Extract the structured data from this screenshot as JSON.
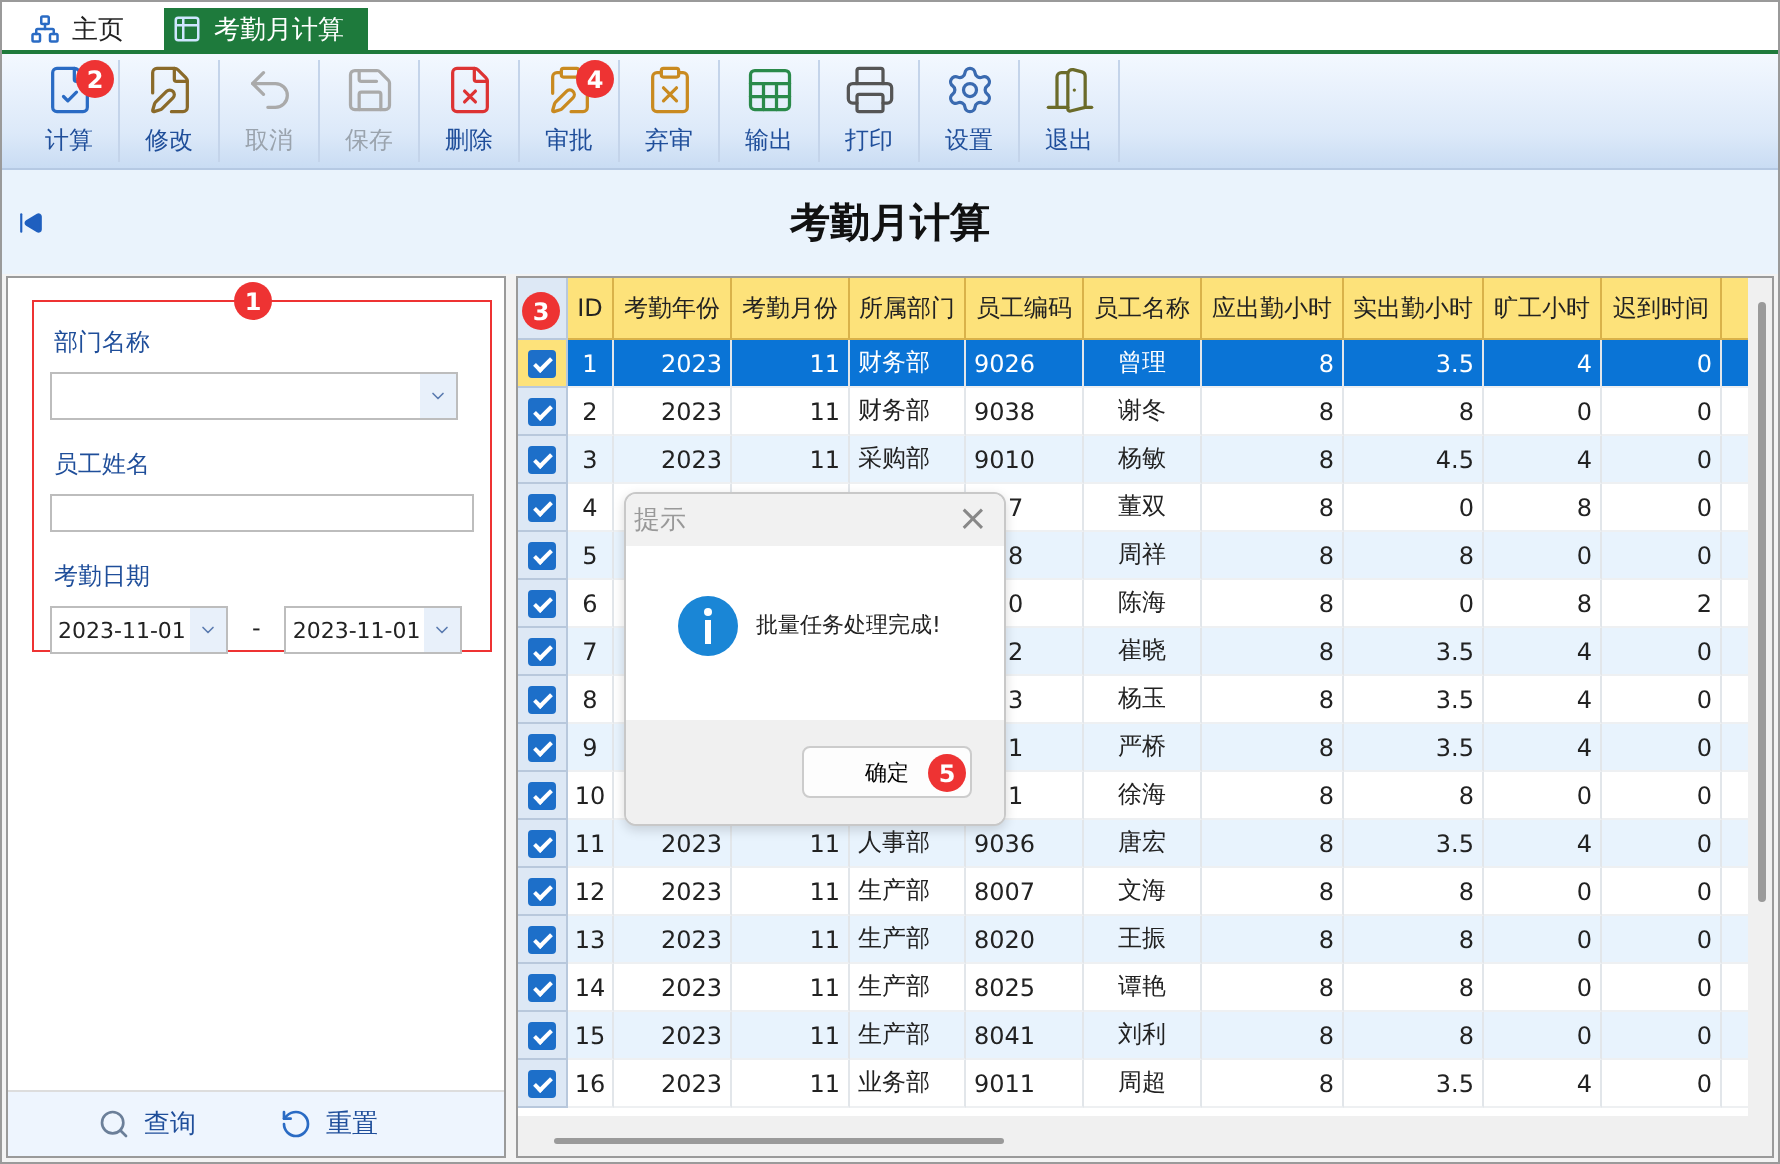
{
  "tabs": [
    {
      "label": "主页",
      "selected": false
    },
    {
      "label": "考勤月计算",
      "selected": true
    }
  ],
  "toolbar": [
    {
      "label": "计算",
      "disabled": false,
      "badge": "2"
    },
    {
      "label": "修改",
      "disabled": false
    },
    {
      "label": "取消",
      "disabled": true
    },
    {
      "label": "保存",
      "disabled": true
    },
    {
      "label": "删除",
      "disabled": false
    },
    {
      "label": "审批",
      "disabled": false,
      "badge": "4"
    },
    {
      "label": "弃审",
      "disabled": false
    },
    {
      "label": "输出",
      "disabled": false
    },
    {
      "label": "打印",
      "disabled": false
    },
    {
      "label": "设置",
      "disabled": false
    },
    {
      "label": "退出",
      "disabled": false
    }
  ],
  "page_title": "考勤月计算",
  "filter": {
    "badge": "1",
    "department_label": "部门名称",
    "name_label": "员工姓名",
    "date_label": "考勤日期",
    "date_from": "2023-11-01",
    "date_separator": "-",
    "date_to": "2023-11-01",
    "buttons": [
      "查询",
      "重置"
    ]
  },
  "table": {
    "header_badge": "3",
    "columns": [
      "ID",
      "考勤年份",
      "考勤月份",
      "所属部门",
      "员工编码",
      "员工名称",
      "应出勤小时",
      "实出勤小时",
      "旷工小时",
      "迟到时间"
    ],
    "rows": [
      {
        "id": "1",
        "year": "2023",
        "month": "11",
        "dept": "财务部",
        "code": "9026",
        "name": "曾理",
        "due": "8",
        "actual": "3.5",
        "absent": "4",
        "late": "0",
        "checked": true,
        "selected": true
      },
      {
        "id": "2",
        "year": "2023",
        "month": "11",
        "dept": "财务部",
        "code": "9038",
        "name": "谢冬",
        "due": "8",
        "actual": "8",
        "absent": "0",
        "late": "0",
        "checked": true,
        "selected": false
      },
      {
        "id": "3",
        "year": "2023",
        "month": "11",
        "dept": "采购部",
        "code": "9010",
        "name": "杨敏",
        "due": "8",
        "actual": "4.5",
        "absent": "4",
        "late": "0",
        "checked": true,
        "selected": false
      },
      {
        "id": "4",
        "code": "7",
        "name": "董双",
        "due": "8",
        "actual": "0",
        "absent": "8",
        "late": "0",
        "checked": true,
        "selected": false
      },
      {
        "id": "5",
        "code": "8",
        "name": "周祥",
        "due": "8",
        "actual": "8",
        "absent": "0",
        "late": "0",
        "checked": true,
        "selected": false
      },
      {
        "id": "6",
        "code": "0",
        "name": "陈海",
        "due": "8",
        "actual": "0",
        "absent": "8",
        "late": "2",
        "checked": true,
        "selected": false
      },
      {
        "id": "7",
        "code": "2",
        "name": "崔晓",
        "due": "8",
        "actual": "3.5",
        "absent": "4",
        "late": "0",
        "checked": true,
        "selected": false
      },
      {
        "id": "8",
        "code": "3",
        "name": "杨玉",
        "due": "8",
        "actual": "3.5",
        "absent": "4",
        "late": "0",
        "checked": true,
        "selected": false
      },
      {
        "id": "9",
        "code": "1",
        "name": "严桥",
        "due": "8",
        "actual": "3.5",
        "absent": "4",
        "late": "0",
        "checked": true,
        "selected": false
      },
      {
        "id": "10",
        "code": "1",
        "name": "徐海",
        "due": "8",
        "actual": "8",
        "absent": "0",
        "late": "0",
        "checked": true,
        "selected": false
      },
      {
        "id": "11",
        "year": "2023",
        "month": "11",
        "dept": "人事部",
        "code": "9036",
        "name": "唐宏",
        "due": "8",
        "actual": "3.5",
        "absent": "4",
        "late": "0",
        "checked": true,
        "selected": false
      },
      {
        "id": "12",
        "year": "2023",
        "month": "11",
        "dept": "生产部",
        "code": "8007",
        "name": "文海",
        "due": "8",
        "actual": "8",
        "absent": "0",
        "late": "0",
        "checked": true,
        "selected": false
      },
      {
        "id": "13",
        "year": "2023",
        "month": "11",
        "dept": "生产部",
        "code": "8020",
        "name": "王振",
        "due": "8",
        "actual": "8",
        "absent": "0",
        "late": "0",
        "checked": true,
        "selected": false
      },
      {
        "id": "14",
        "year": "2023",
        "month": "11",
        "dept": "生产部",
        "code": "8025",
        "name": "谭艳",
        "due": "8",
        "actual": "8",
        "absent": "0",
        "late": "0",
        "checked": true,
        "selected": false
      },
      {
        "id": "15",
        "year": "2023",
        "month": "11",
        "dept": "生产部",
        "code": "8041",
        "name": "刘利",
        "due": "8",
        "actual": "8",
        "absent": "0",
        "late": "0",
        "checked": true,
        "selected": false
      },
      {
        "id": "16",
        "year": "2023",
        "month": "11",
        "dept": "业务部",
        "code": "9011",
        "name": "周超",
        "due": "8",
        "actual": "3.5",
        "absent": "4",
        "late": "0",
        "checked": true,
        "selected": false
      }
    ]
  },
  "dialog": {
    "title": "提示",
    "close": "×",
    "message": "批量任务处理完成!",
    "button": "确定",
    "badge": "5"
  }
}
